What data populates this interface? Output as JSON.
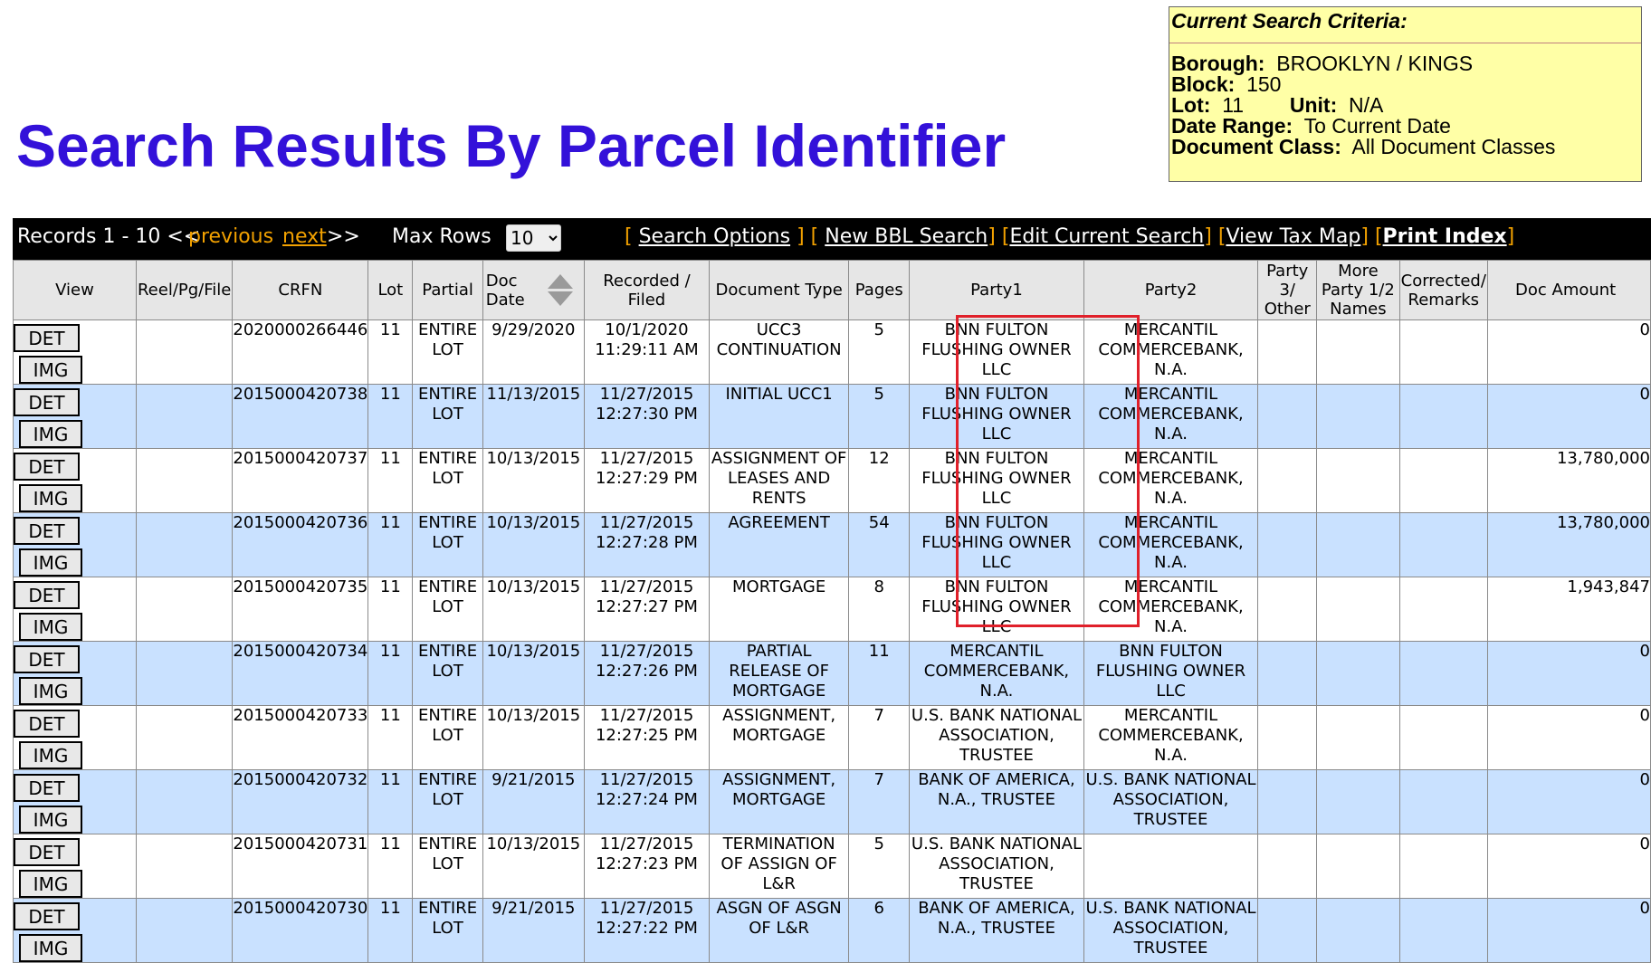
{
  "title": "Search Results By Parcel Identifier",
  "criteria": {
    "heading": "Current Search Criteria:",
    "borough_label": "Borough:",
    "borough": "BROOKLYN / KINGS",
    "block_label": "Block:",
    "block": "150",
    "lot_label": "Lot:",
    "lot": "11",
    "unit_label": "Unit:",
    "unit": "N/A",
    "date_range_label": "Date Range:",
    "date_range": "To Current Date",
    "doc_class_label": "Document Class:",
    "doc_class": "All Document Classes"
  },
  "toolbar": {
    "records": "Records 1 - 10 <<",
    "previous": "previous",
    "next": "next",
    "next_arrows": ">>",
    "max_rows_label": "Max Rows",
    "max_rows": "10",
    "search_options": "Search Options",
    "new_bbl": "New BBL Search",
    "edit_search": "Edit Current Search",
    "view_tax_map": "View Tax Map",
    "print_index": "Print Index"
  },
  "columns": {
    "view": "View",
    "reel": "Reel/Pg/File",
    "crfn": "CRFN",
    "lot": "Lot",
    "partial": "Partial",
    "doc_date": "Doc Date",
    "recorded": "Recorded / Filed",
    "doc_type": "Document Type",
    "pages": "Pages",
    "party1": "Party1",
    "party2": "Party2",
    "party3": "Party 3/ Other",
    "more_party": "More Party 1/2 Names",
    "corrected": "Corrected/ Remarks",
    "doc_amount": "Doc Amount"
  },
  "buttons": {
    "det": "DET",
    "img": "IMG"
  },
  "rows": [
    {
      "crfn": "2020000266446",
      "lot": "11",
      "partial": "ENTIRE LOT",
      "doc_date": "9/29/2020",
      "recorded": "10/1/2020 11:29:11 AM",
      "doc_type": "UCC3 CONTINUATION",
      "pages": "5",
      "party1": "BNN FULTON FLUSHING OWNER LLC",
      "party2": "MERCANTIL COMMERCEBANK, N.A.",
      "amount": "0"
    },
    {
      "crfn": "2015000420738",
      "lot": "11",
      "partial": "ENTIRE LOT",
      "doc_date": "11/13/2015",
      "recorded": "11/27/2015 12:27:30 PM",
      "doc_type": "INITIAL UCC1",
      "pages": "5",
      "party1": "BNN FULTON FLUSHING OWNER LLC",
      "party2": "MERCANTIL COMMERCEBANK, N.A.",
      "amount": "0"
    },
    {
      "crfn": "2015000420737",
      "lot": "11",
      "partial": "ENTIRE LOT",
      "doc_date": "10/13/2015",
      "recorded": "11/27/2015 12:27:29 PM",
      "doc_type": "ASSIGNMENT OF LEASES AND RENTS",
      "pages": "12",
      "party1": "BNN FULTON FLUSHING OWNER LLC",
      "party2": "MERCANTIL COMMERCEBANK, N.A.",
      "amount": "13,780,000"
    },
    {
      "crfn": "2015000420736",
      "lot": "11",
      "partial": "ENTIRE LOT",
      "doc_date": "10/13/2015",
      "recorded": "11/27/2015 12:27:28 PM",
      "doc_type": "AGREEMENT",
      "pages": "54",
      "party1": "BNN FULTON FLUSHING OWNER LLC",
      "party2": "MERCANTIL COMMERCEBANK, N.A.",
      "amount": "13,780,000"
    },
    {
      "crfn": "2015000420735",
      "lot": "11",
      "partial": "ENTIRE LOT",
      "doc_date": "10/13/2015",
      "recorded": "11/27/2015 12:27:27 PM",
      "doc_type": "MORTGAGE",
      "pages": "8",
      "party1": "BNN FULTON FLUSHING OWNER LLC",
      "party2": "MERCANTIL COMMERCEBANK, N.A.",
      "amount": "1,943,847"
    },
    {
      "crfn": "2015000420734",
      "lot": "11",
      "partial": "ENTIRE LOT",
      "doc_date": "10/13/2015",
      "recorded": "11/27/2015 12:27:26 PM",
      "doc_type": "PARTIAL RELEASE OF MORTGAGE",
      "pages": "11",
      "party1": "MERCANTIL COMMERCEBANK, N.A.",
      "party2": "BNN FULTON FLUSHING OWNER LLC",
      "amount": "0"
    },
    {
      "crfn": "2015000420733",
      "lot": "11",
      "partial": "ENTIRE LOT",
      "doc_date": "10/13/2015",
      "recorded": "11/27/2015 12:27:25 PM",
      "doc_type": "ASSIGNMENT, MORTGAGE",
      "pages": "7",
      "party1": "U.S. BANK NATIONAL ASSOCIATION, TRUSTEE",
      "party2": "MERCANTIL COMMERCEBANK, N.A.",
      "amount": "0"
    },
    {
      "crfn": "2015000420732",
      "lot": "11",
      "partial": "ENTIRE LOT",
      "doc_date": "9/21/2015",
      "recorded": "11/27/2015 12:27:24 PM",
      "doc_type": "ASSIGNMENT, MORTGAGE",
      "pages": "7",
      "party1": "BANK OF AMERICA, N.A., TRUSTEE",
      "party2": "U.S. BANK NATIONAL ASSOCIATION, TRUSTEE",
      "amount": "0"
    },
    {
      "crfn": "2015000420731",
      "lot": "11",
      "partial": "ENTIRE LOT",
      "doc_date": "10/13/2015",
      "recorded": "11/27/2015 12:27:23 PM",
      "doc_type": "TERMINATION OF ASSIGN OF L&R",
      "pages": "5",
      "party1": "U.S. BANK NATIONAL ASSOCIATION, TRUSTEE",
      "party2": "",
      "amount": "0"
    },
    {
      "crfn": "2015000420730",
      "lot": "11",
      "partial": "ENTIRE LOT",
      "doc_date": "9/21/2015",
      "recorded": "11/27/2015 12:27:22 PM",
      "doc_type": "ASGN OF ASGN OF L&R",
      "pages": "6",
      "party1": "BANK OF AMERICA, N.A., TRUSTEE",
      "party2": "U.S. BANK NATIONAL ASSOCIATION, TRUSTEE",
      "amount": "0"
    }
  ],
  "colors": {
    "title": "#3311d9",
    "criteria_bg": "#ffffa6",
    "row_alt": "#c9e1ff",
    "highlight": "#e0202a",
    "toolbar_link": "#f2a100"
  }
}
